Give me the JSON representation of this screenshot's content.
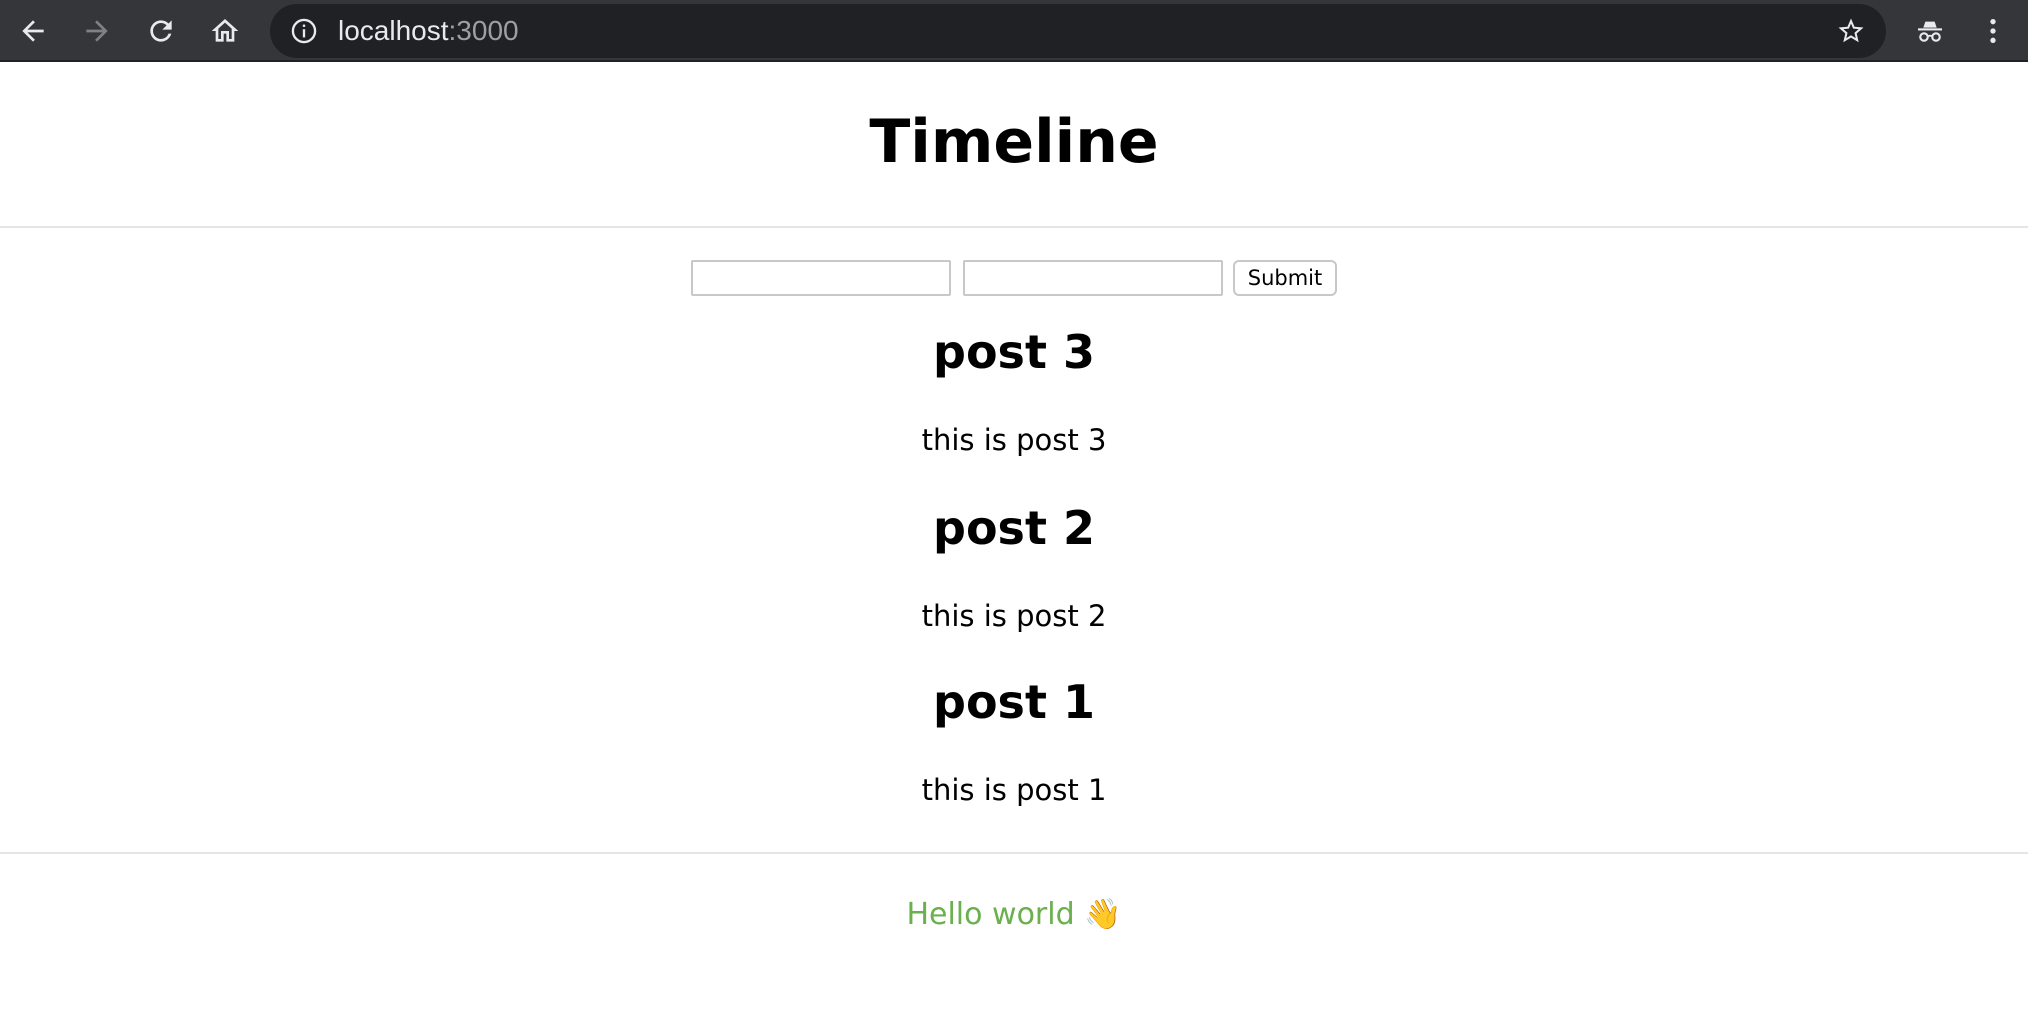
{
  "browser": {
    "url_host": "localhost",
    "url_port": ":3000",
    "back_icon": "back-arrow-icon",
    "forward_icon": "forward-arrow-icon",
    "reload_icon": "reload-icon",
    "home_icon": "home-icon",
    "info_icon": "info-icon",
    "bookmark_icon": "star-icon",
    "incognito_icon": "incognito-icon",
    "menu_icon": "kebab-menu-icon"
  },
  "header": {
    "title": "Timeline"
  },
  "form": {
    "title_value": "",
    "body_value": "",
    "submit_label": "Submit"
  },
  "posts": [
    {
      "title": "post 3",
      "body": "this is post 3"
    },
    {
      "title": "post 2",
      "body": "this is post 2"
    },
    {
      "title": "post 1",
      "body": "this is post 1"
    }
  ],
  "footer": {
    "text": "Hello world 👋",
    "color": "#6ab04c"
  }
}
